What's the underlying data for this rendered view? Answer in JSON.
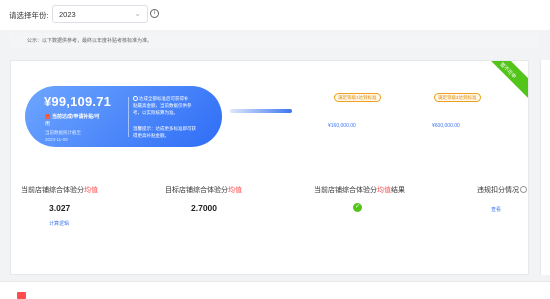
{
  "filter": {
    "label": "请选择年份:",
    "year": "2023",
    "chevron_icon": "chevron-down-icon",
    "info_icon": "info-icon"
  },
  "notice": {
    "text": "公示：以下数据供参考，最终以年度补贴考核标准为准。"
  },
  "summary": {
    "amount": "¥99,109.71",
    "status_line1": "当前达成/申请补贴/可",
    "status_line2": "用",
    "updated_line1": "当前数据统计截至",
    "updated_line2": "2023-11-09",
    "desc_line1": "达成全部标准后可获得补",
    "desc_line2": "贴最高金额，当前数据仅供参",
    "desc_line3": "考，以实际核算为准。",
    "desc_line4": "",
    "tip_line1": "温馨提示：达成更多标准即可获",
    "tip_line2": "得更高补贴金额。"
  },
  "progress": {
    "fraction": 0.6
  },
  "tiers": [
    {
      "tag": "满足等级1达到标准",
      "amount": "¥160,000.00"
    },
    {
      "tag": "满足等级2达到标准",
      "amount": "¥600,000.00"
    }
  ],
  "ribbon": {
    "text": "暂不可申"
  },
  "metrics": {
    "current_label_pre": "当前店铺综合体验分",
    "current_label_red": "均值",
    "current_value": "3.027",
    "calc_link": "计算逻辑",
    "target_label_pre": "目标店铺综合体验分",
    "target_label_red": "均值",
    "target_value": "2.7000",
    "result_label_pre": "当前店铺综合体验分",
    "result_label_red": "均值",
    "result_label_post": "结果",
    "violation_label": "违规扣分情况",
    "view_link": "查看"
  },
  "colors": {
    "accent": "#3d76f2",
    "success": "#52c41a",
    "warning": "#f0a020",
    "danger": "#ff4d4f"
  }
}
